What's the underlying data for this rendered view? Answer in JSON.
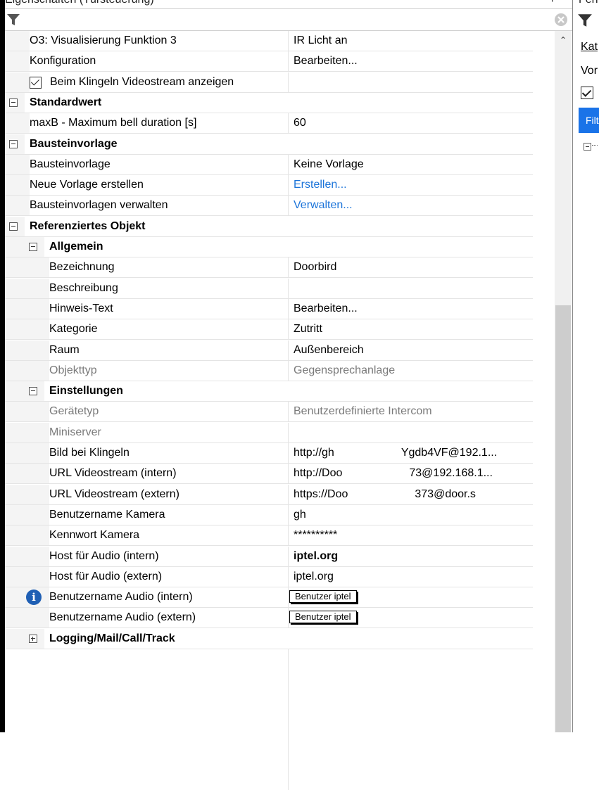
{
  "panel": {
    "title": "Eigenschaften (Türsteuerung)",
    "pin_symbol": "+"
  },
  "rows": [
    {
      "label": "O3: Visualisierung Funktion 3",
      "value": "IR Licht an",
      "indent": 1
    },
    {
      "label": "Konfiguration",
      "value": "Bearbeiten...",
      "indent": 1
    },
    {
      "label": "Beim Klingeln Videostream anzeigen",
      "value": "",
      "indent": 1,
      "checkbox": true,
      "checked": true
    },
    {
      "label": "Standardwert",
      "category": true,
      "indent": 0,
      "expanded": true
    },
    {
      "label": "maxB - Maximum bell duration [s]",
      "value": "60",
      "indent": 1
    },
    {
      "label": "Bausteinvorlage",
      "category": true,
      "indent": 0,
      "expanded": true
    },
    {
      "label": "Bausteinvorlage",
      "value": "Keine Vorlage",
      "indent": 1
    },
    {
      "label": "Neue Vorlage erstellen",
      "value": "Erstellen...",
      "indent": 1,
      "link": true
    },
    {
      "label": "Bausteinvorlagen verwalten",
      "value": "Verwalten...",
      "indent": 1,
      "link": true
    },
    {
      "label": "Referenziertes Objekt",
      "category": true,
      "indent": 0,
      "expanded": true
    },
    {
      "label": "Allgemein",
      "category": true,
      "indent": 1,
      "expanded": true
    },
    {
      "label": "Bezeichnung",
      "value": "Doorbird",
      "indent": 2
    },
    {
      "label": "Beschreibung",
      "value": "",
      "indent": 2
    },
    {
      "label": "Hinweis-Text",
      "value": "Bearbeiten...",
      "indent": 2
    },
    {
      "label": "Kategorie",
      "value": "Zutritt",
      "indent": 2
    },
    {
      "label": "Raum",
      "value": "Außenbereich",
      "indent": 2
    },
    {
      "label": "Objekttyp",
      "value": "Gegensprechanlage",
      "indent": 2,
      "gray": true
    },
    {
      "label": "Einstellungen",
      "category": true,
      "indent": 1,
      "expanded": true
    },
    {
      "label": "Gerätetyp",
      "value": "Benutzerdefinierte Intercom",
      "indent": 2,
      "gray": true
    },
    {
      "label": "Miniserver",
      "value": "",
      "indent": 2,
      "gray": true
    },
    {
      "label": "Bild bei Klingeln",
      "value": "http://gh",
      "value_tail": "Ygdb4VF@192.1...",
      "indent": 2
    },
    {
      "label": "URL Videostream (intern)",
      "value": "http://Doo",
      "value_tail": "73@192.168.1...",
      "indent": 2
    },
    {
      "label": "URL Videostream (extern)",
      "value": "https://Doo",
      "value_tail": "373@door.s",
      "indent": 2
    },
    {
      "label": "Benutzername Kamera",
      "value": "gh",
      "indent": 2
    },
    {
      "label": "Kennwort Kamera",
      "value": "**********",
      "indent": 2
    },
    {
      "label": "Host für Audio (intern)",
      "value": "iptel.org",
      "indent": 2,
      "bold_value": true
    },
    {
      "label": "Host für Audio (extern)",
      "value": "iptel.org",
      "indent": 2
    },
    {
      "label": "Benutzername Audio (intern)",
      "value": "",
      "indent": 2,
      "tag": "Benutzer iptel",
      "info_icon": true
    },
    {
      "label": "Benutzername Audio (extern)",
      "value": "",
      "indent": 2,
      "tag": "Benutzer iptel"
    },
    {
      "label": "Logging/Mail/Call/Track",
      "category": true,
      "indent": 1,
      "expanded": false
    }
  ],
  "right_panel": {
    "top_text": "Fen",
    "tab_text": "Kat",
    "second_text": "Vor",
    "button_text": "Filt"
  },
  "colors": {
    "link": "#1a73d9",
    "gray_text": "#7a7a7a",
    "margin": "#f4f4f4",
    "info": "#1f5fb4",
    "accent": "#1a73e8"
  },
  "icons": {
    "filter": "filter-icon",
    "clear": "clear-filter-icon",
    "info": "info-icon",
    "scroll_up": "scroll-up-icon"
  }
}
